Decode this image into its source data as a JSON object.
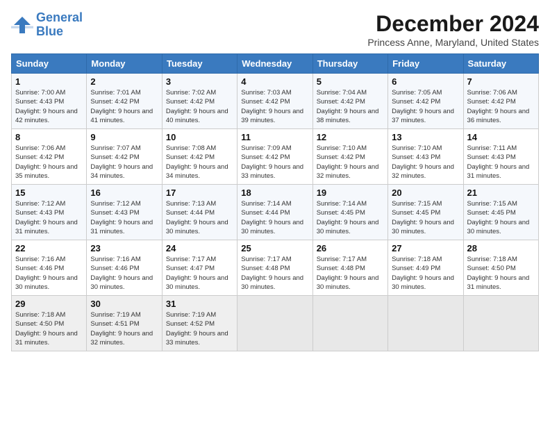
{
  "logo": {
    "line1": "General",
    "line2": "Blue"
  },
  "title": "December 2024",
  "subtitle": "Princess Anne, Maryland, United States",
  "weekdays": [
    "Sunday",
    "Monday",
    "Tuesday",
    "Wednesday",
    "Thursday",
    "Friday",
    "Saturday"
  ],
  "weeks": [
    [
      {
        "day": 1,
        "sunrise": "7:00 AM",
        "sunset": "4:43 PM",
        "daylight": "9 hours and 42 minutes."
      },
      {
        "day": 2,
        "sunrise": "7:01 AM",
        "sunset": "4:42 PM",
        "daylight": "9 hours and 41 minutes."
      },
      {
        "day": 3,
        "sunrise": "7:02 AM",
        "sunset": "4:42 PM",
        "daylight": "9 hours and 40 minutes."
      },
      {
        "day": 4,
        "sunrise": "7:03 AM",
        "sunset": "4:42 PM",
        "daylight": "9 hours and 39 minutes."
      },
      {
        "day": 5,
        "sunrise": "7:04 AM",
        "sunset": "4:42 PM",
        "daylight": "9 hours and 38 minutes."
      },
      {
        "day": 6,
        "sunrise": "7:05 AM",
        "sunset": "4:42 PM",
        "daylight": "9 hours and 37 minutes."
      },
      {
        "day": 7,
        "sunrise": "7:06 AM",
        "sunset": "4:42 PM",
        "daylight": "9 hours and 36 minutes."
      }
    ],
    [
      {
        "day": 8,
        "sunrise": "7:06 AM",
        "sunset": "4:42 PM",
        "daylight": "9 hours and 35 minutes."
      },
      {
        "day": 9,
        "sunrise": "7:07 AM",
        "sunset": "4:42 PM",
        "daylight": "9 hours and 34 minutes."
      },
      {
        "day": 10,
        "sunrise": "7:08 AM",
        "sunset": "4:42 PM",
        "daylight": "9 hours and 34 minutes."
      },
      {
        "day": 11,
        "sunrise": "7:09 AM",
        "sunset": "4:42 PM",
        "daylight": "9 hours and 33 minutes."
      },
      {
        "day": 12,
        "sunrise": "7:10 AM",
        "sunset": "4:42 PM",
        "daylight": "9 hours and 32 minutes."
      },
      {
        "day": 13,
        "sunrise": "7:10 AM",
        "sunset": "4:43 PM",
        "daylight": "9 hours and 32 minutes."
      },
      {
        "day": 14,
        "sunrise": "7:11 AM",
        "sunset": "4:43 PM",
        "daylight": "9 hours and 31 minutes."
      }
    ],
    [
      {
        "day": 15,
        "sunrise": "7:12 AM",
        "sunset": "4:43 PM",
        "daylight": "9 hours and 31 minutes."
      },
      {
        "day": 16,
        "sunrise": "7:12 AM",
        "sunset": "4:43 PM",
        "daylight": "9 hours and 31 minutes."
      },
      {
        "day": 17,
        "sunrise": "7:13 AM",
        "sunset": "4:44 PM",
        "daylight": "9 hours and 30 minutes."
      },
      {
        "day": 18,
        "sunrise": "7:14 AM",
        "sunset": "4:44 PM",
        "daylight": "9 hours and 30 minutes."
      },
      {
        "day": 19,
        "sunrise": "7:14 AM",
        "sunset": "4:45 PM",
        "daylight": "9 hours and 30 minutes."
      },
      {
        "day": 20,
        "sunrise": "7:15 AM",
        "sunset": "4:45 PM",
        "daylight": "9 hours and 30 minutes."
      },
      {
        "day": 21,
        "sunrise": "7:15 AM",
        "sunset": "4:45 PM",
        "daylight": "9 hours and 30 minutes."
      }
    ],
    [
      {
        "day": 22,
        "sunrise": "7:16 AM",
        "sunset": "4:46 PM",
        "daylight": "9 hours and 30 minutes."
      },
      {
        "day": 23,
        "sunrise": "7:16 AM",
        "sunset": "4:46 PM",
        "daylight": "9 hours and 30 minutes."
      },
      {
        "day": 24,
        "sunrise": "7:17 AM",
        "sunset": "4:47 PM",
        "daylight": "9 hours and 30 minutes."
      },
      {
        "day": 25,
        "sunrise": "7:17 AM",
        "sunset": "4:48 PM",
        "daylight": "9 hours and 30 minutes."
      },
      {
        "day": 26,
        "sunrise": "7:17 AM",
        "sunset": "4:48 PM",
        "daylight": "9 hours and 30 minutes."
      },
      {
        "day": 27,
        "sunrise": "7:18 AM",
        "sunset": "4:49 PM",
        "daylight": "9 hours and 30 minutes."
      },
      {
        "day": 28,
        "sunrise": "7:18 AM",
        "sunset": "4:50 PM",
        "daylight": "9 hours and 31 minutes."
      }
    ],
    [
      {
        "day": 29,
        "sunrise": "7:18 AM",
        "sunset": "4:50 PM",
        "daylight": "9 hours and 31 minutes."
      },
      {
        "day": 30,
        "sunrise": "7:19 AM",
        "sunset": "4:51 PM",
        "daylight": "9 hours and 32 minutes."
      },
      {
        "day": 31,
        "sunrise": "7:19 AM",
        "sunset": "4:52 PM",
        "daylight": "9 hours and 33 minutes."
      },
      null,
      null,
      null,
      null
    ]
  ]
}
